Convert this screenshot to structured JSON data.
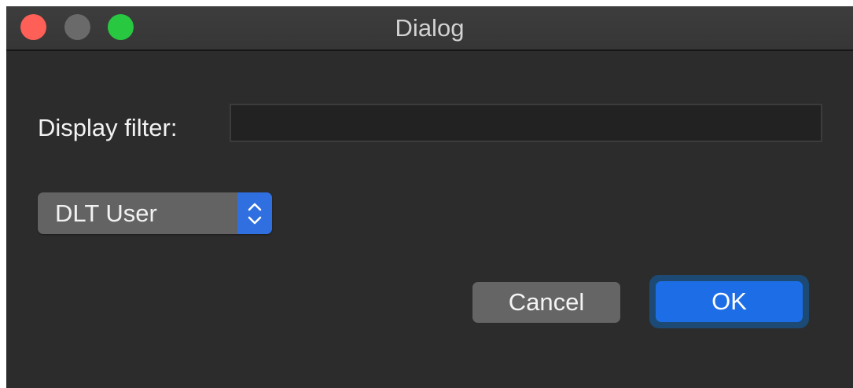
{
  "window": {
    "title": "Dialog"
  },
  "filter": {
    "label": "Display filter:",
    "value": "",
    "placeholder": ""
  },
  "popup": {
    "selected": "DLT User"
  },
  "buttons": {
    "cancel": "Cancel",
    "ok": "OK"
  },
  "colors": {
    "close": "#fe5f57",
    "minimize": "#6a6a6a",
    "zoom": "#28c840",
    "accent": "#1d6ee6",
    "background": "#2c2c2c"
  }
}
